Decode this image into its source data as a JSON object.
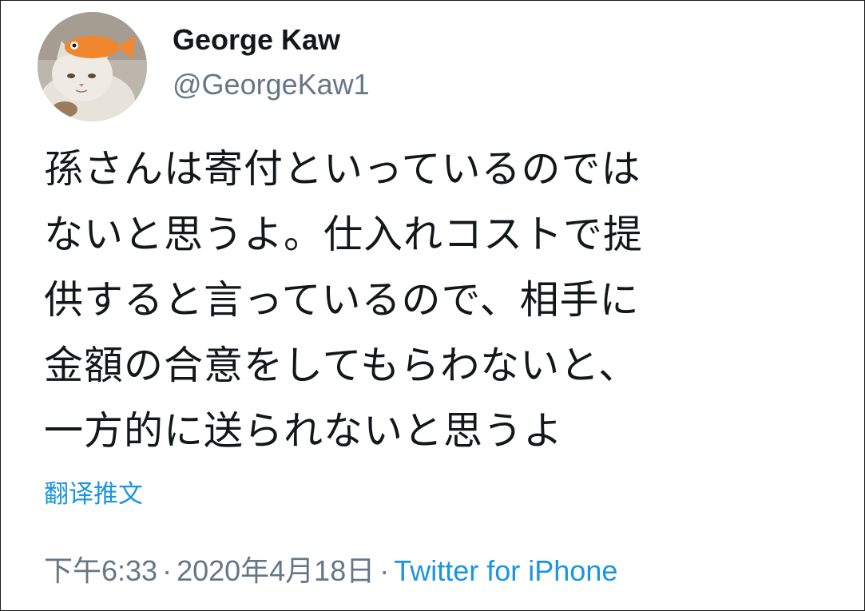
{
  "author": {
    "display_name": "George Kaw",
    "handle": "@GeorgeKaw1",
    "avatar_icon": "cat-avatar-icon"
  },
  "tweet": {
    "lines": [
      "孫さんは寄付といっているのでは",
      "ないと思うよ。仕入れコストで提",
      "供すると言っているので、相手に",
      "金額の合意をしてもらわないと、",
      "一方的に送られないと思うよ"
    ]
  },
  "translate_label": "翻译推文",
  "meta": {
    "time": "下午6:33",
    "separator": "·",
    "date": "2020年4月18日",
    "source": "Twitter for iPhone"
  },
  "colors": {
    "text": "#14171a",
    "secondary": "#657786",
    "link": "#1b95e0"
  }
}
